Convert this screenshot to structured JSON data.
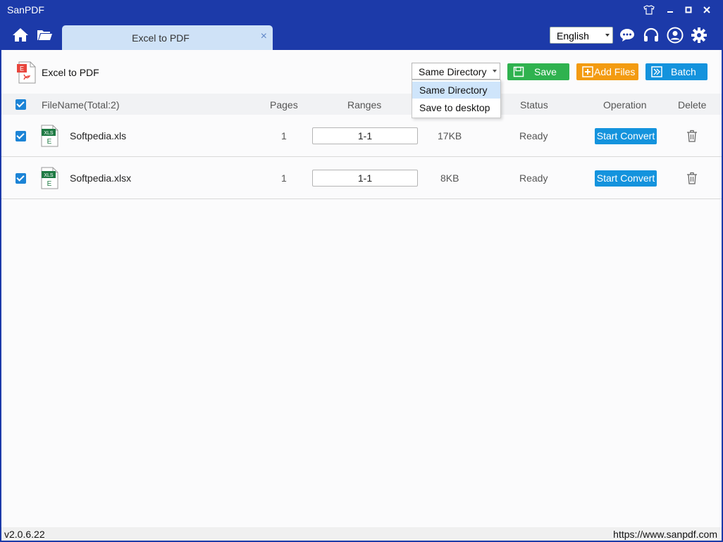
{
  "window": {
    "title": "SanPDF"
  },
  "tab": {
    "label": "Excel to PDF",
    "close": "×"
  },
  "header": {
    "language": "English"
  },
  "toolbar": {
    "title": "Excel to PDF",
    "directory": "Same Directory",
    "save_label": "Save",
    "add_files_label": "Add Files",
    "batch_label": "Batch"
  },
  "dropdown": {
    "options": [
      "Same Directory",
      "Save to desktop"
    ]
  },
  "table": {
    "headers": {
      "filename": "FileName(Total:2)",
      "pages": "Pages",
      "ranges": "Ranges",
      "status": "Status",
      "operation": "Operation",
      "delete": "Delete"
    },
    "rows": [
      {
        "name": "Softpedia.xls",
        "pages": "1",
        "range": "1-1",
        "size": "17KB",
        "status": "Ready",
        "action": "Start Convert"
      },
      {
        "name": "Softpedia.xlsx",
        "pages": "1",
        "range": "1-1",
        "size": "8KB",
        "status": "Ready",
        "action": "Start Convert"
      }
    ]
  },
  "footer": {
    "version": "v2.0.6.22",
    "url": "https://www.sanpdf.com"
  },
  "icons": {
    "pdf": "E",
    "xls_tag": "XLS",
    "xls_letter": "E"
  }
}
